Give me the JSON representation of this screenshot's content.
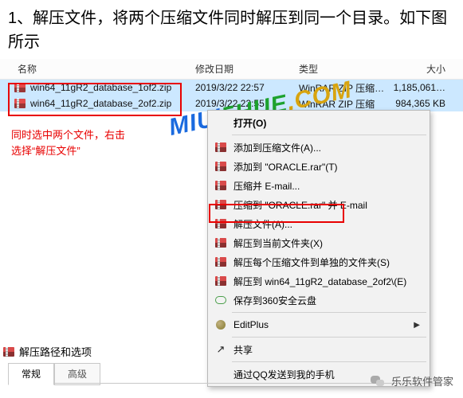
{
  "instruction": "1、解压文件，将两个压缩文件同时解压到同一个目录。如下图所示",
  "headers": {
    "name": "名称",
    "date": "修改日期",
    "type": "类型",
    "size": "大小"
  },
  "files": [
    {
      "name": "win64_11gR2_database_1of2.zip",
      "date": "2019/3/22 22:57",
      "type": "WinRAR ZIP 压缩…",
      "size": "1,185,061…"
    },
    {
      "name": "win64_11gR2_database_2of2.zip",
      "date": "2019/3/22 22:55",
      "type": "WinRAR ZIP 压缩",
      "size": "984,365 KB"
    }
  ],
  "tip1": "同时选中两个文件，右击",
  "tip2": "选择“解压文件”",
  "watermark": "MIUI5HUE.COM",
  "menu": {
    "open": "打开(O)",
    "add": "添加到压缩文件(A)...",
    "addto": "添加到 \"ORACLE.rar\"(T)",
    "zipmail": "压缩并 E-mail...",
    "ziptomail": "压缩到 \"ORACLE.rar\" 并 E-mail",
    "extract": "解压文件(A)...",
    "extracthere": "解压到当前文件夹(X)",
    "extracteach": "解压每个压缩文件到单独的文件夹(S)",
    "extractto": "解压到 win64_11gR2_database_2of2\\(E)",
    "save360": "保存到360安全云盘",
    "editplus": "EditPlus",
    "share": "共享",
    "qq": "通过QQ发送到我的手机"
  },
  "dialog_title": "解压路径和选项",
  "tabs": {
    "normal": "常规",
    "advanced": "高级"
  },
  "footer": "乐乐软件管家"
}
